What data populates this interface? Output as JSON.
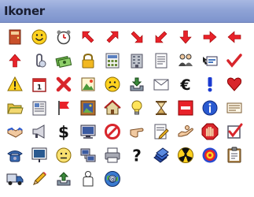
{
  "header": {
    "title": "Ikoner"
  },
  "icons": [
    [
      "door-icon",
      "smiley-icon",
      "alarm-clock-icon",
      "arrow-up-left-icon",
      "arrow-up-right-icon",
      "arrow-down-right-icon",
      "arrow-down-left-icon",
      "arrow-down-icon",
      "arrow-right-icon",
      "arrow-left-icon"
    ],
    [
      "arrow-up-icon",
      "paperclip-icon",
      "money-icon",
      "lock-icon",
      "calculator-icon",
      "building-icon",
      "document-icon",
      "users-icon",
      "card-pointer-icon",
      "checkmark-icon"
    ],
    [
      "warning-icon",
      "calendar-icon",
      "red-x-icon",
      "picture-icon",
      "frown-icon",
      "download-tray-icon",
      "envelope-icon",
      "euro-icon",
      "exclamation-icon",
      "heart-icon"
    ],
    [
      "folder-open-icon",
      "newspaper-icon",
      "flag-icon",
      "framed-picture-icon",
      "house-icon",
      "lightbulb-icon",
      "hourglass-icon",
      "no-entry-icon",
      "info-icon",
      "note-icon"
    ],
    [
      "handshake-icon",
      "megaphone-icon",
      "dollar-icon",
      "monitor-icon",
      "prohibited-icon",
      "pointing-hand-icon",
      "edit-document-icon",
      "give-hand-icon",
      "stop-hand-icon",
      "checkbox-icon"
    ],
    [
      "telephone-icon",
      "presentation-icon",
      "pale-face-icon",
      "network-computer-icon",
      "printer-icon",
      "question-mark-icon",
      "books-icon",
      "radiation-icon",
      "target-icon",
      "clipboard-icon"
    ],
    [
      "truck-icon",
      "pencil-icon",
      "upload-tray-icon",
      "person-icon",
      "globe-at-icon"
    ]
  ]
}
